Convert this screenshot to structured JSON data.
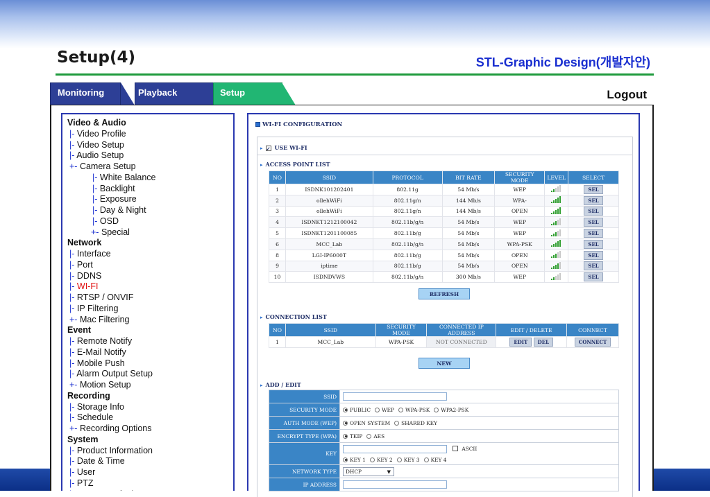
{
  "slide": {
    "title": "Setup(4)",
    "subtitle": "STL-Graphic Design(개발자안)"
  },
  "tabs": {
    "monitoring": "Monitoring",
    "playback": "Playback",
    "setup": "Setup",
    "logout": "Logout"
  },
  "sidebar": [
    {
      "label": "Video & Audio",
      "type": "head"
    },
    {
      "prefix": "|-",
      "label": "Video Profile",
      "type": "l1"
    },
    {
      "prefix": "|-",
      "label": "Video Setup",
      "type": "l1"
    },
    {
      "prefix": "|-",
      "label": "Audio Setup",
      "type": "l1"
    },
    {
      "prefix": "+-",
      "label": "Camera Setup",
      "type": "l1"
    },
    {
      "prefix": "|-",
      "label": "White Balance",
      "type": "l2"
    },
    {
      "prefix": "|-",
      "label": "Backlight",
      "type": "l2"
    },
    {
      "prefix": "|-",
      "label": "Exposure",
      "type": "l2"
    },
    {
      "prefix": "|-",
      "label": "Day & Night",
      "type": "l2"
    },
    {
      "prefix": "|-",
      "label": "OSD",
      "type": "l2"
    },
    {
      "prefix": "+-",
      "label": "Special",
      "type": "l2b"
    },
    {
      "label": "Network",
      "type": "head"
    },
    {
      "prefix": "|-",
      "label": "Interface",
      "type": "l1"
    },
    {
      "prefix": "|-",
      "label": "Port",
      "type": "l1"
    },
    {
      "prefix": "|-",
      "label": "DDNS",
      "type": "l1"
    },
    {
      "prefix": "|-",
      "label": "WI-FI",
      "type": "l1",
      "active": true
    },
    {
      "prefix": "|-",
      "label": "RTSP / ONVIF",
      "type": "l1"
    },
    {
      "prefix": "|-",
      "label": "IP Filtering",
      "type": "l1"
    },
    {
      "prefix": "+-",
      "label": "Mac Filtering",
      "type": "l1"
    },
    {
      "label": "Event",
      "type": "head"
    },
    {
      "prefix": "|-",
      "label": "Remote Notify",
      "type": "l1"
    },
    {
      "prefix": "|-",
      "label": "E-Mail Notify",
      "type": "l1"
    },
    {
      "prefix": "|-",
      "label": "Mobile Push",
      "type": "l1"
    },
    {
      "prefix": "|-",
      "label": "Alarm Output Setup",
      "type": "l1"
    },
    {
      "prefix": "+-",
      "label": "Motion Setup",
      "type": "l1"
    },
    {
      "label": "Recording",
      "type": "head"
    },
    {
      "prefix": "|-",
      "label": "Storage Info",
      "type": "l1"
    },
    {
      "prefix": "|-",
      "label": "Schedule",
      "type": "l1"
    },
    {
      "prefix": "+-",
      "label": "Recording Options",
      "type": "l1"
    },
    {
      "label": "System",
      "type": "head"
    },
    {
      "prefix": "|-",
      "label": "Product Information",
      "type": "l1"
    },
    {
      "prefix": "|-",
      "label": "Date & Time",
      "type": "l1"
    },
    {
      "prefix": "|-",
      "label": "User",
      "type": "l1"
    },
    {
      "prefix": "|-",
      "label": "PTZ",
      "type": "l1"
    },
    {
      "prefix": "|-",
      "label": "Factory Default",
      "type": "l1"
    }
  ],
  "wifi": {
    "title": "WI-FI CONFIGURATION",
    "use_wifi": "USE WI-FI",
    "use_wifi_checked": true,
    "ap_section": "ACCESS POINT LIST",
    "ap_headers": [
      "NO",
      "SSID",
      "PROTOCOL",
      "BIT RATE",
      "SECURITY MODE",
      "LEVEL",
      "SELECT"
    ],
    "ap_rows": [
      {
        "no": "1",
        "ssid": "ISDNK101202401",
        "protocol": "802.11g",
        "rate": "54 Mb/s",
        "security": "WEP",
        "level": 2,
        "select": "SEL"
      },
      {
        "no": "2",
        "ssid": "ollehWiFi",
        "protocol": "802.11g/n",
        "rate": "144 Mb/s",
        "security": "WPA-",
        "level": 5,
        "select": "SEL"
      },
      {
        "no": "3",
        "ssid": "ollehWiFi",
        "protocol": "802.11g/n",
        "rate": "144 Mb/s",
        "security": "OPEN",
        "level": 5,
        "select": "SEL"
      },
      {
        "no": "4",
        "ssid": "ISDNKT1212100042",
        "protocol": "802.11b/g/n",
        "rate": "54 Mb/s",
        "security": "WEP",
        "level": 3,
        "select": "SEL"
      },
      {
        "no": "5",
        "ssid": "ISDNKT1201100085",
        "protocol": "802.11b/g",
        "rate": "54 Mb/s",
        "security": "WEP",
        "level": 3,
        "select": "SEL"
      },
      {
        "no": "6",
        "ssid": "MCC_Lab",
        "protocol": "802.11b/g/n",
        "rate": "54 Mb/s",
        "security": "WPA-PSK",
        "level": 5,
        "select": "SEL"
      },
      {
        "no": "8",
        "ssid": "LGI-IP6000T",
        "protocol": "802.11b/g",
        "rate": "54 Mb/s",
        "security": "OPEN",
        "level": 3,
        "select": "SEL"
      },
      {
        "no": "9",
        "ssid": "iptime",
        "protocol": "802.11b/g",
        "rate": "54 Mb/s",
        "security": "OPEN",
        "level": 4,
        "select": "SEL"
      },
      {
        "no": "10",
        "ssid": "ISDNDVWS",
        "protocol": "802.11b/g/n",
        "rate": "300 Mb/s",
        "security": "WEP",
        "level": 2,
        "select": "SEL"
      }
    ],
    "refresh": "REFRESH",
    "conn_section": "CONNECTION LIST",
    "conn_headers": [
      "NO",
      "SSID",
      "SECURITY MODE",
      "CONNECTED IP ADDRESS",
      "EDIT / DELETE",
      "CONNECT"
    ],
    "conn_rows": [
      {
        "no": "1",
        "ssid": "MCC_Lab",
        "security": "WPA-PSK",
        "ip": "NOT CONNECTED",
        "edit": "EDIT",
        "del": "DEL",
        "connect": "CONNECT"
      }
    ],
    "new": "NEW",
    "add_section": "ADD / EDIT",
    "form": {
      "ssid_label": "SSID",
      "ssid_value": "",
      "secmode_label": "SECURITY MODE",
      "secmode_options": [
        "PUBLIC",
        "WEP",
        "WPA-PSK",
        "WPA2-PSK"
      ],
      "secmode_selected": "PUBLIC",
      "auth_label": "AUTH MODE (WEP)",
      "auth_options": [
        "OPEN SYSTEM",
        "SHARED KEY"
      ],
      "auth_selected": "OPEN SYSTEM",
      "enc_label": "ENCRYPT TYPE (WPA)",
      "enc_options": [
        "TKIP",
        "AES"
      ],
      "enc_selected": "TKIP",
      "key_label": "KEY",
      "key_value": "",
      "ascii_label": "ASCII",
      "key_options": [
        "KEY 1",
        "KEY 2",
        "KEY 3",
        "KEY 4"
      ],
      "key_selected": "KEY 1",
      "nettype_label": "NETWORK TYPE",
      "nettype_value": "DHCP",
      "ip_label": "IP ADDRESS",
      "ip_value": ""
    }
  },
  "colors": {
    "tab_blue": "#2d3f96",
    "tab_green": "#21b673",
    "header_blue": "#3a85c6",
    "accent_red": "#e01010",
    "rule_green": "#1e9a3c"
  }
}
